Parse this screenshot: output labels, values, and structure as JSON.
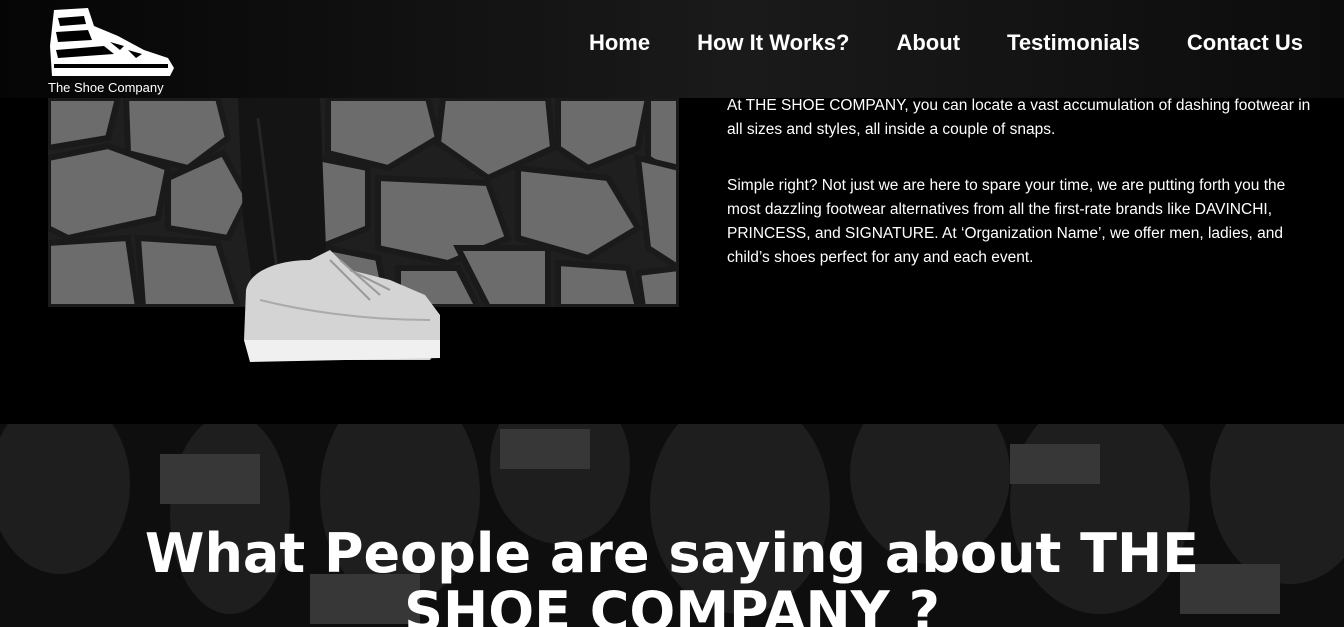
{
  "brand": {
    "name": "The Shoe Company",
    "logo_icon": "sneaker-icon"
  },
  "nav": {
    "items": [
      {
        "label": "Home"
      },
      {
        "label": "How It Works?"
      },
      {
        "label": "About"
      },
      {
        "label": "Testimonials"
      },
      {
        "label": "Contact Us"
      }
    ]
  },
  "about": {
    "paragraph1": "At THE SHOE COMPANY, you can locate a vast accumulation of dashing footwear in all sizes and styles, all inside a couple of snaps.",
    "paragraph2": "Simple right? Not just we are here to spare your time, we are putting forth you the most dazzling footwear alternatives from all the first-rate brands like DAVINCHI, PRINCESS, and SIGNATURE. At ‘Organization Name’, we offer men, ladies, and child’s shoes perfect for any and each event."
  },
  "testimonials": {
    "title": "What People are saying about THE SHOE COMPANY ?"
  },
  "colors": {
    "background": "#000000",
    "text": "#ffffff",
    "pavement": "#6e6e6e"
  }
}
